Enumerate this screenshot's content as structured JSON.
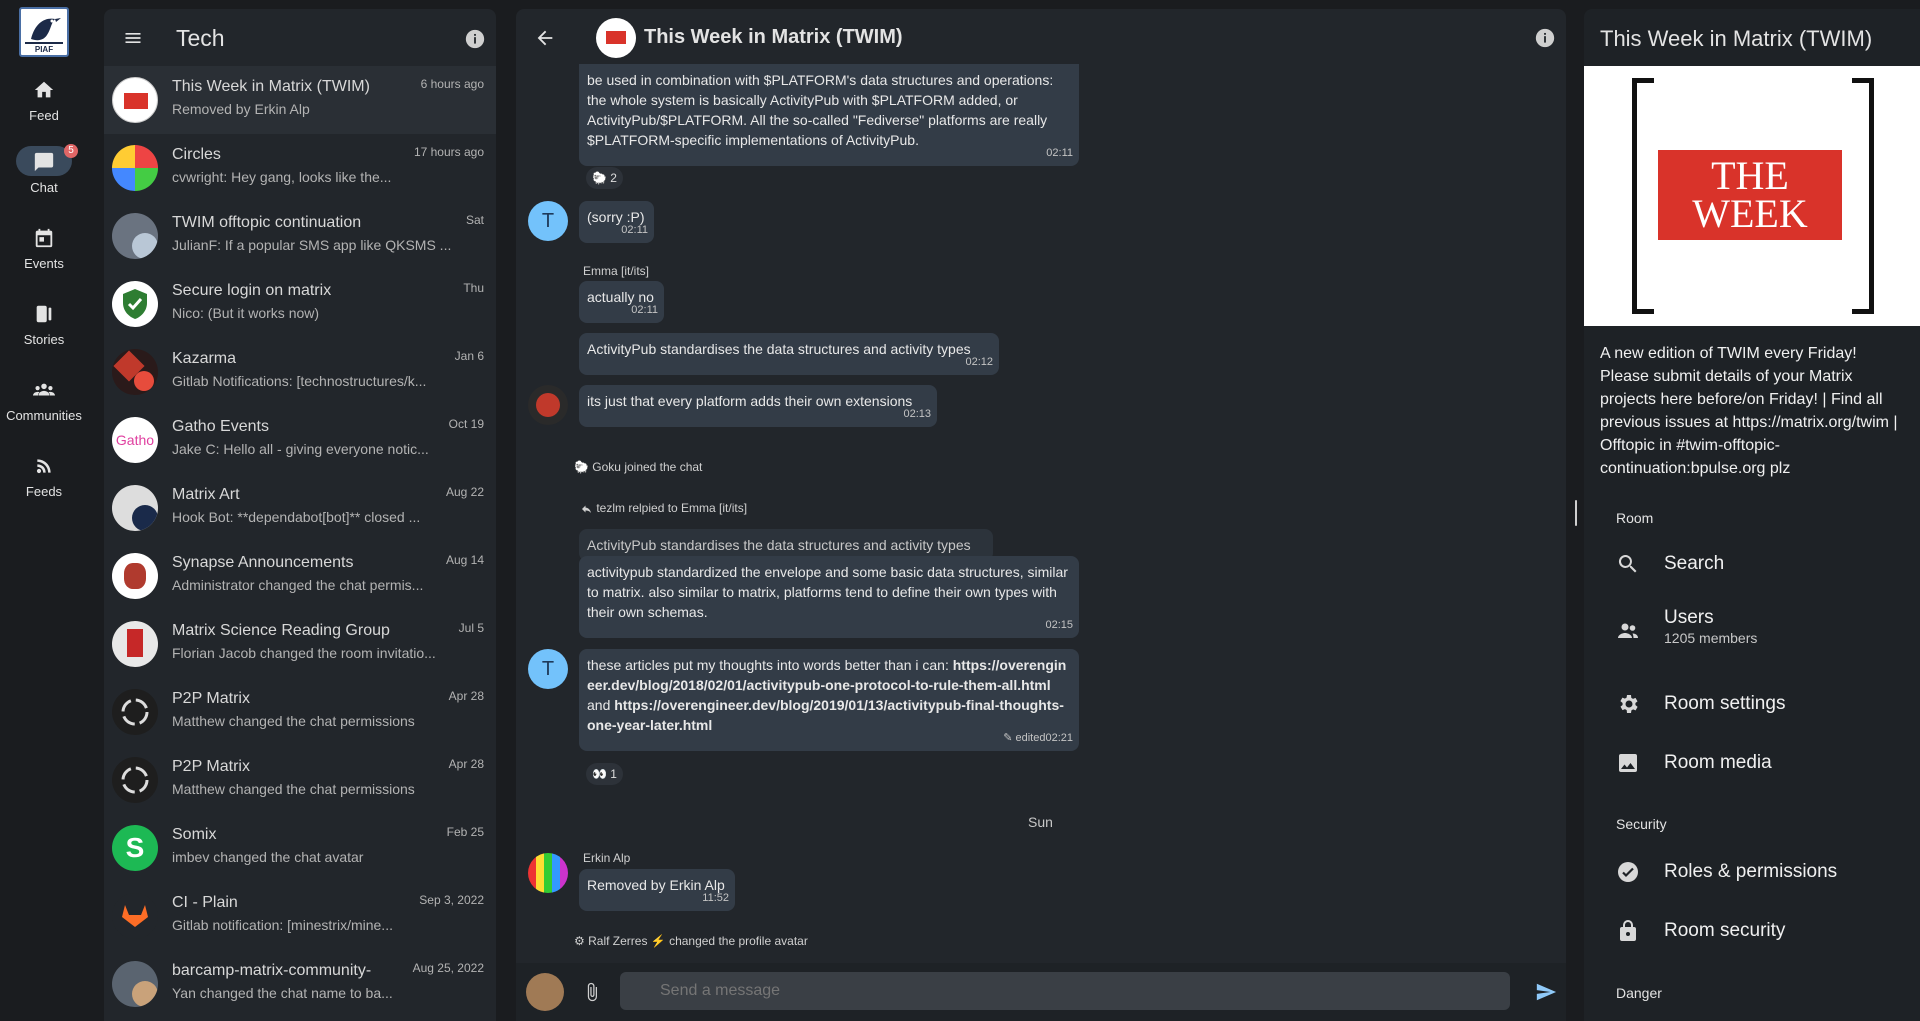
{
  "rail": {
    "logo_text": "PIAF",
    "items": [
      {
        "label": "Feed"
      },
      {
        "label": "Chat",
        "badge": "5"
      },
      {
        "label": "Events"
      },
      {
        "label": "Stories"
      },
      {
        "label": "Communities"
      },
      {
        "label": "Feeds"
      }
    ]
  },
  "list": {
    "title": "Tech",
    "rooms": [
      {
        "name": "This Week in Matrix (TWIM)",
        "preview": "Removed by Erkin Alp",
        "time": "6 hours ago"
      },
      {
        "name": "Circles",
        "preview": "cvwright: Hey gang, looks like the...",
        "time": "17 hours ago"
      },
      {
        "name": "TWIM offtopic continuation",
        "preview": "JulianF: If a popular SMS app like QKSMS ...",
        "time": "Sat"
      },
      {
        "name": "Secure login on matrix",
        "preview": "Nico: (But it works now)",
        "time": "Thu"
      },
      {
        "name": "Kazarma",
        "preview": "Gitlab Notifications: [technostructures/k...",
        "time": "Jan 6"
      },
      {
        "name": "Gatho Events",
        "preview": "Jake C: Hello all - giving everyone notic...",
        "time": "Oct 19"
      },
      {
        "name": "Matrix Art",
        "preview": "Hook Bot: **dependabot[bot]** closed ...",
        "time": "Aug 22"
      },
      {
        "name": "Synapse Announcements",
        "preview": "Administrator changed the chat permis...",
        "time": "Aug 14"
      },
      {
        "name": "Matrix Science Reading Group",
        "preview": "Florian Jacob changed the room invitatio...",
        "time": "Jul 5"
      },
      {
        "name": "P2P Matrix",
        "preview": "Matthew changed the chat permissions",
        "time": "Apr 28"
      },
      {
        "name": "P2P Matrix",
        "preview": "Matthew changed the chat permissions",
        "time": "Apr 28"
      },
      {
        "name": "Somix",
        "preview": "imbev changed the chat avatar",
        "time": "Feb 25"
      },
      {
        "name": "CI - Plain",
        "preview": "Gitlab notification: [minestrix/mine...",
        "time": "Sep 3, 2022"
      },
      {
        "name": "barcamp-matrix-community-",
        "preview": "Yan changed the chat name to ba...",
        "time": "Aug 25, 2022"
      }
    ]
  },
  "chat": {
    "title": "This Week in Matrix (TWIM)",
    "m1_text": "be used in combination with $PLATFORM's data structures and operations: the whole system is basically ActivityPub with $PLATFORM added, or ActivityPub/$PLATFORM. All the so-called \"Fediverse\" platforms are really $PLATFORM-specific implementations of ActivityPub.",
    "m1_time": "02:11",
    "m1_react": "2",
    "m2_avatar": "T",
    "m2_text": "(sorry :P)",
    "m2_time": "02:11",
    "m3_sender": "Emma [it/its]",
    "m3_text": "actually no",
    "m3_time": "02:11",
    "m4_text": "ActivityPub standardises the data structures and activity types",
    "m4_time": "02:12",
    "m5_text": "its just that every platform adds their own extensions",
    "m5_time": "02:13",
    "sys1": "Goku joined the chat",
    "reply_header": "tezlm relpied to Emma [it/its]",
    "reply_quote": "ActivityPub standardises the data structures and activity types",
    "m6_text": "activitypub standardized the envelope and some basic data structures, similar to matrix. also similar to matrix, platforms tend to define their own types with their own schemas.",
    "m6_time": "02:15",
    "m7_avatar": "T",
    "m7_text_a": "these articles put my thoughts into words better than i can: ",
    "m7_link1": "https://overengineer.dev/blog/2018/02/01/activitypub-one-protocol-to-rule-them-all.html",
    "m7_text_b": " and ",
    "m7_link2": "https://overengineer.dev/blog/2019/01/13/activitypub-final-thoughts-one-year-later.html",
    "m7_edited": "edited",
    "m7_time": "02:21",
    "m7_react": "1",
    "day": "Sun",
    "m8_sender": "Erkin Alp",
    "m8_text": "Removed by Erkin Alp",
    "m8_time": "11:52",
    "sys2": "Ralf Zerres ⚡ changed the profile avatar",
    "placeholder": "Send a message"
  },
  "side": {
    "title": "This Week in Matrix (TWIM)",
    "img_text": "THE WEEK",
    "desc": "A new edition of TWIM every Friday! Please submit details of your Matrix projects here before/on Friday! | Find all previous issues at https://matrix.org/twim | Offtopic in #twim-offtopic-continuation:bpulse.org plz",
    "room_label": "Room",
    "search": "Search",
    "users": "Users",
    "members": "1205 members",
    "settings": "Room settings",
    "media": "Room media",
    "security_label": "Security",
    "roles": "Roles & permissions",
    "room_security": "Room security",
    "danger_label": "Danger"
  }
}
